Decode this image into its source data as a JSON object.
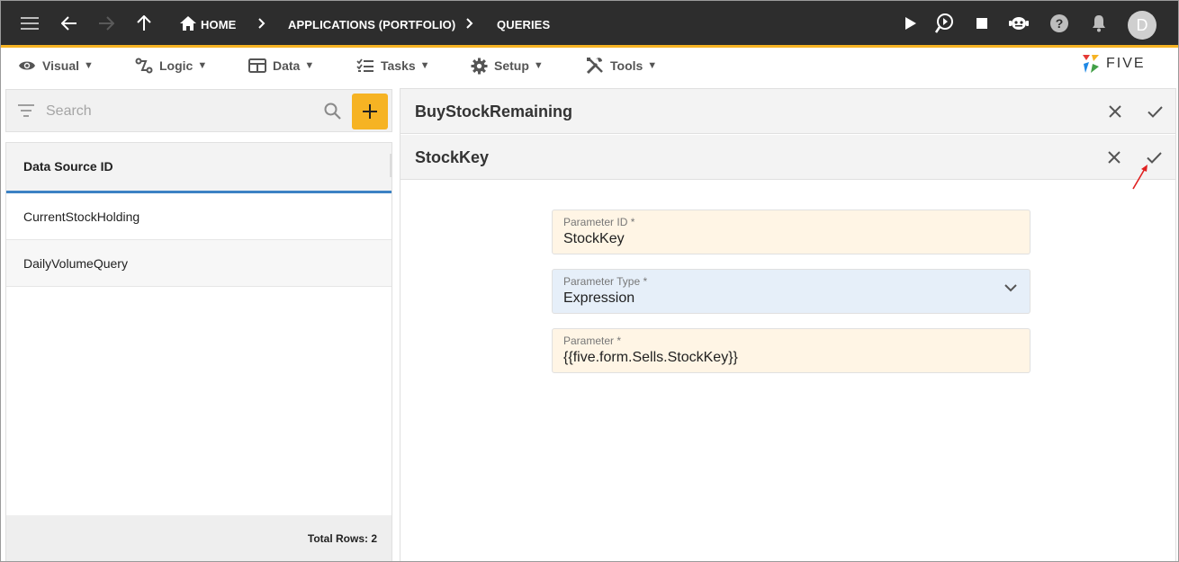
{
  "topbar": {
    "breadcrumbs": [
      "HOME",
      "APPLICATIONS (PORTFOLIO)",
      "QUERIES"
    ],
    "avatar_initial": "D"
  },
  "menubar": {
    "items": [
      {
        "label": "Visual",
        "icon": "eye-icon"
      },
      {
        "label": "Logic",
        "icon": "logic-icon"
      },
      {
        "label": "Data",
        "icon": "table-icon"
      },
      {
        "label": "Tasks",
        "icon": "tasks-icon"
      },
      {
        "label": "Setup",
        "icon": "gear-icon"
      },
      {
        "label": "Tools",
        "icon": "tools-icon"
      }
    ],
    "logo_text": "FIVE"
  },
  "left": {
    "search_placeholder": "Search",
    "column_header": "Data Source ID",
    "rows": [
      "CurrentStockHolding",
      "DailyVolumeQuery"
    ],
    "footer": "Total Rows: 2"
  },
  "right": {
    "parent_title": "BuyStockRemaining",
    "child_title": "StockKey",
    "fields": [
      {
        "label": "Parameter ID *",
        "value": "StockKey"
      },
      {
        "label": "Parameter Type *",
        "value": "Expression"
      },
      {
        "label": "Parameter *",
        "value": "{{five.form.Sells.StockKey}}"
      }
    ]
  },
  "colors": {
    "topbar_bg": "#2d2d2d",
    "accent": "#f6b323",
    "tab_underline": "#3c82c4",
    "annotation_arrow": "#e02020"
  }
}
